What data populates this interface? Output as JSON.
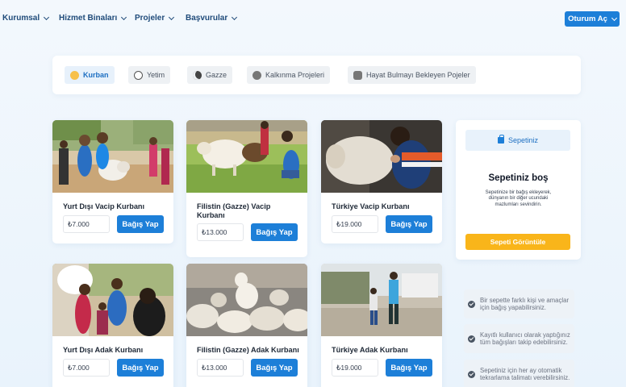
{
  "nav": {
    "items": [
      "Kurumsal",
      "Hizmet Binaları",
      "Projeler",
      "Başvurular"
    ],
    "login_label": "Oturum Aç"
  },
  "categories": [
    {
      "label": "Kurban",
      "active": true,
      "icon": "kurban-icon"
    },
    {
      "label": "Yetim",
      "active": false,
      "icon": "yetim-icon"
    },
    {
      "label": "Gazze",
      "active": false,
      "icon": "crescent-icon"
    },
    {
      "label": "Kalkınma Projeleri",
      "active": false,
      "icon": "people-icon"
    },
    {
      "label": "Hayat Bulmayı Bekleyen Pojeler",
      "active": false,
      "icon": "hands-icon"
    }
  ],
  "cards": [
    {
      "title": "Yurt Dışı Vacip Kurbanı",
      "price": "₺7.000",
      "button": "Bağış Yap"
    },
    {
      "title": "Filistin (Gazze) Vacip Kurbanı",
      "price": "₺13.000",
      "button": "Bağış Yap"
    },
    {
      "title": "Türkiye Vacip Kurbanı",
      "price": "₺19.000",
      "button": "Bağış Yap"
    },
    {
      "title": "Yurt Dışı Adak Kurbanı",
      "price": "₺7.000",
      "button": "Bağış Yap"
    },
    {
      "title": "Filistin (Gazze) Adak Kurbanı",
      "price": "₺13.000",
      "button": "Bağış Yap"
    },
    {
      "title": "Türkiye Adak Kurbanı",
      "price": "₺19.000",
      "button": "Bağış Yap"
    }
  ],
  "cart": {
    "tab_label": "Sepetiniz",
    "empty_title": "Sepetiniz boş",
    "empty_text": "Sepetinize bir bağış ekleyerek, dünyanın bir diğer ucundaki mazlumları sevindirin.",
    "button_label": "Sepeti Görüntüle"
  },
  "info": [
    "Bir sepette farklı kişi ve amaçlar için bağış yapabilirsiniz.",
    "Kayıtlı kullanıcı olarak yaptığınız tüm bağışları takip edebilirsiniz.",
    "Sepetiniz için her ay otomatik tekrarlama talimatı verebilirsiniz."
  ],
  "colors": {
    "primary": "#1d7fd8",
    "accent": "#f9b51a",
    "nav_text": "#1f4b7a"
  }
}
